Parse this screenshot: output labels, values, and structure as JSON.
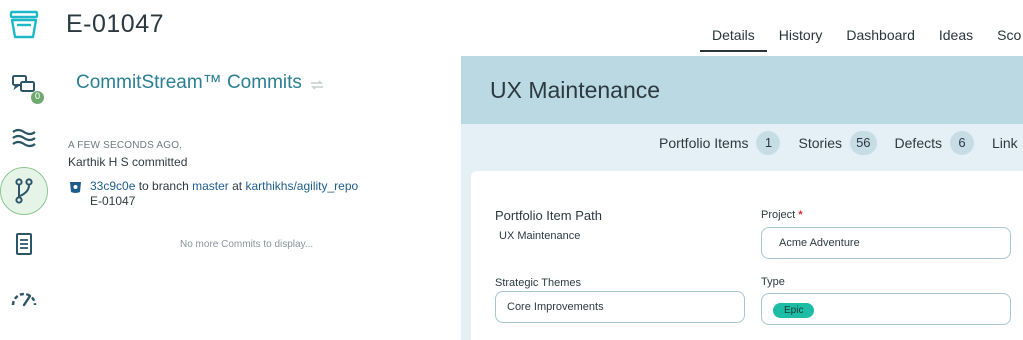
{
  "header": {
    "item_id": "E-01047"
  },
  "tabs": [
    {
      "label": "Details",
      "active": true
    },
    {
      "label": "History",
      "active": false
    },
    {
      "label": "Dashboard",
      "active": false
    },
    {
      "label": "Ideas",
      "active": false
    },
    {
      "label": "Sco",
      "active": false
    }
  ],
  "rail": {
    "icons": [
      "inbox-icon",
      "conversations-icon",
      "waves-icon",
      "branch-icon",
      "document-icon",
      "gauge-icon"
    ],
    "conversations_badge": "0"
  },
  "commitstream": {
    "title": "CommitStream™ Commits",
    "time": "A FEW SECONDS AGO,",
    "author_line": "Karthik H S committed",
    "commit_hash": "33c9c0e",
    "to_branch_text": " to branch ",
    "branch": "master",
    "at_text": " at ",
    "repo": "karthikhs/agility_repo",
    "commit_item": "E-01047",
    "empty_message": "No more Commits to display..."
  },
  "detail": {
    "title": "UX Maintenance",
    "counts": [
      {
        "label": "Portfolio Items",
        "value": "1"
      },
      {
        "label": "Stories",
        "value": "56"
      },
      {
        "label": "Defects",
        "value": "6"
      },
      {
        "label": "Link",
        "value": ""
      }
    ],
    "fields": {
      "portfolio_path_label": "Portfolio Item Path",
      "portfolio_path_value": "UX Maintenance",
      "project_label": "Project",
      "project_required": "*",
      "project_value": "Acme Adventure",
      "themes_label": "Strategic Themes",
      "themes_value": "Core Improvements",
      "type_label": "Type",
      "type_value": "Epic"
    }
  },
  "colors": {
    "accent_teal": "#2a7f92",
    "header_band": "#bad9e3",
    "body_band": "#e4f0f5",
    "epic_tag": "#1dbca4",
    "active_rail": "#e6f4e8"
  }
}
